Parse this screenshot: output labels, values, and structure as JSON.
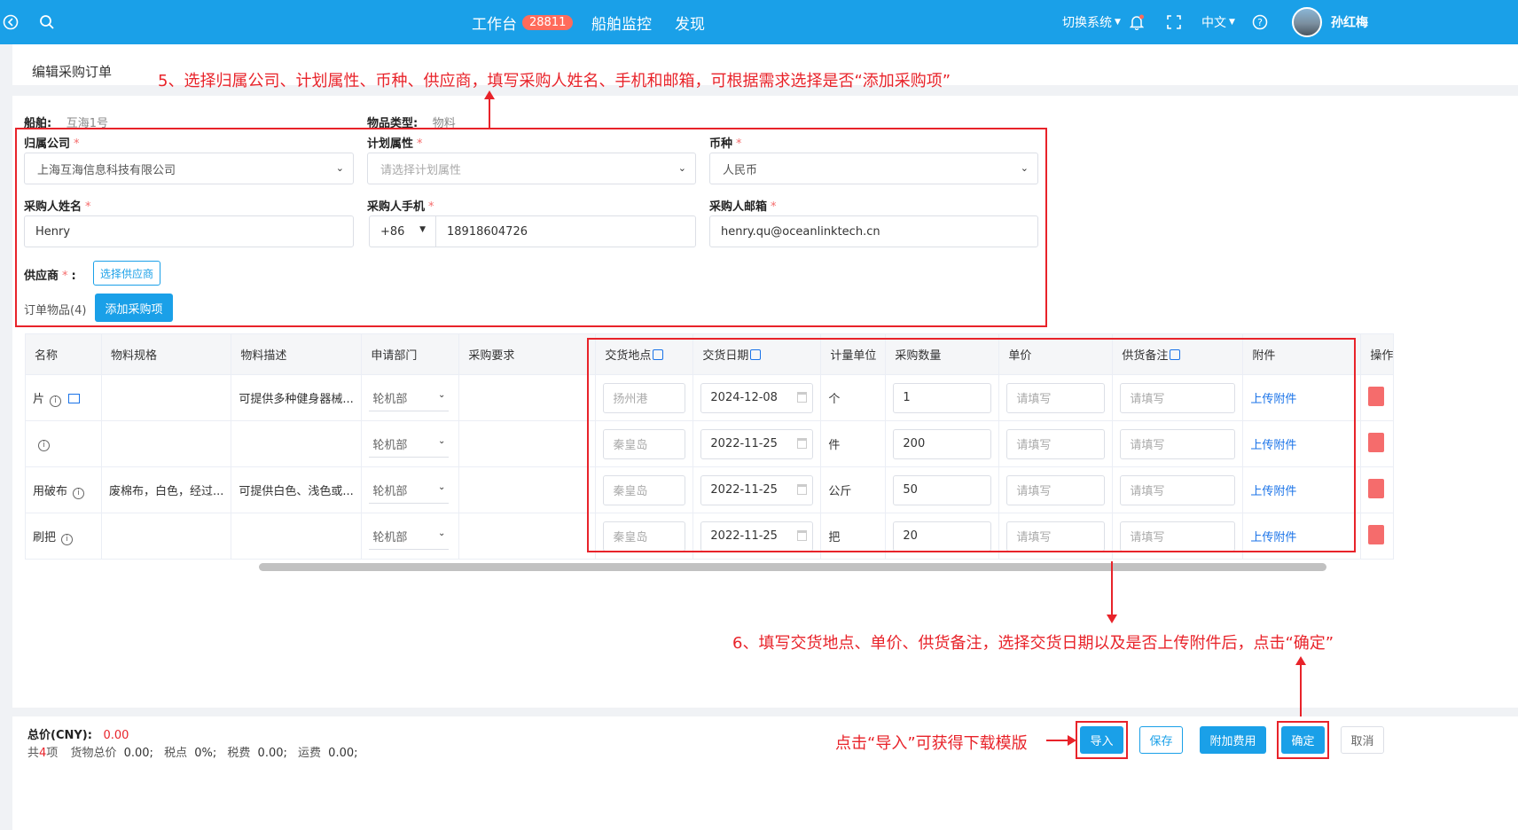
{
  "topbar": {
    "nav": [
      {
        "label": "工作台",
        "badge": "28811"
      },
      {
        "label": "船舶监控"
      },
      {
        "label": "发现"
      }
    ],
    "switch_system": "切换系统",
    "language": "中文",
    "user_name": "孙红梅"
  },
  "page": {
    "title": "编辑采购订单"
  },
  "annotations": {
    "step5": "5、选择归属公司、计划属性、币种、供应商，填写采购人姓名、手机和邮箱，可根据需求选择是否“添加采购项”",
    "step6": "6、填写交货地点、单价、供货备注，选择交货日期以及是否上传附件后，点击“确定”",
    "import_hint": "点击“导入”可获得下载模版"
  },
  "form": {
    "vessel_label": "船舶:",
    "vessel_value": "互海1号",
    "item_type_label": "物品类型:",
    "item_type_value": "物料",
    "company_label": "归属公司",
    "company_value": "上海互海信息科技有限公司",
    "plan_attr_label": "计划属性",
    "plan_attr_placeholder": "请选择计划属性",
    "currency_label": "币种",
    "currency_value": "人民币",
    "buyer_name_label": "采购人姓名",
    "buyer_name_value": "Henry",
    "buyer_phone_label": "采购人手机",
    "phone_code": "+86",
    "buyer_phone_value": "18918604726",
    "buyer_email_label": "采购人邮箱",
    "buyer_email_value": "henry.qu@oceanlinktech.cn",
    "supplier_label": "供应商",
    "supplier_colon": ":",
    "select_supplier_button": "选择供应商",
    "order_items_label": "订单物品(4)",
    "add_item_button": "添加采购项",
    "required_mark": "*"
  },
  "table": {
    "headers": [
      "名称",
      "物料规格",
      "物料描述",
      "申请部门",
      "采购要求",
      "交货地点",
      "交货日期",
      "计量单位",
      "采购数量",
      "单价",
      "供货备注",
      "附件",
      "操作"
    ],
    "placeholder": "请填写",
    "upload_label": "上传附件",
    "rows": [
      {
        "name": "片",
        "spec": "",
        "desc": "可提供多种健身器械...",
        "dept": "轮机部",
        "place": "扬州港",
        "date": "2024-12-08",
        "unit": "个",
        "qty": "1"
      },
      {
        "name": "",
        "spec": "",
        "desc": "",
        "dept": "轮机部",
        "place": "秦皇岛",
        "date": "2022-11-25",
        "unit": "件",
        "qty": "200"
      },
      {
        "name": "用破布",
        "spec": "废棉布，白色，经过...",
        "desc": "可提供白色、浅色或...",
        "dept": "轮机部",
        "place": "秦皇岛",
        "date": "2022-11-25",
        "unit": "公斤",
        "qty": "50"
      },
      {
        "name": "刷把",
        "spec": "",
        "desc": "",
        "dept": "轮机部",
        "place": "秦皇岛",
        "date": "2022-11-25",
        "unit": "把",
        "qty": "20"
      }
    ]
  },
  "footer": {
    "total_label": "总价(CNY):",
    "total_value": "0.00",
    "count_prefix": "共",
    "count_value": "4",
    "count_suffix": "项",
    "goods_total_label": "货物总价",
    "goods_total_value": "0.00;",
    "tax_rate_label": "税点",
    "tax_rate_value": "0%;",
    "tax_label": "税费",
    "tax_value": "0.00;",
    "freight_label": "运费",
    "freight_value": "0.00;",
    "buttons": {
      "import": "导入",
      "save": "保存",
      "extra_fee": "附加费用",
      "confirm": "确定",
      "cancel": "取消"
    }
  },
  "colors": {
    "primary": "#1aa0e8",
    "annotation_red": "#e8232a",
    "badge": "#ff6b5b"
  }
}
